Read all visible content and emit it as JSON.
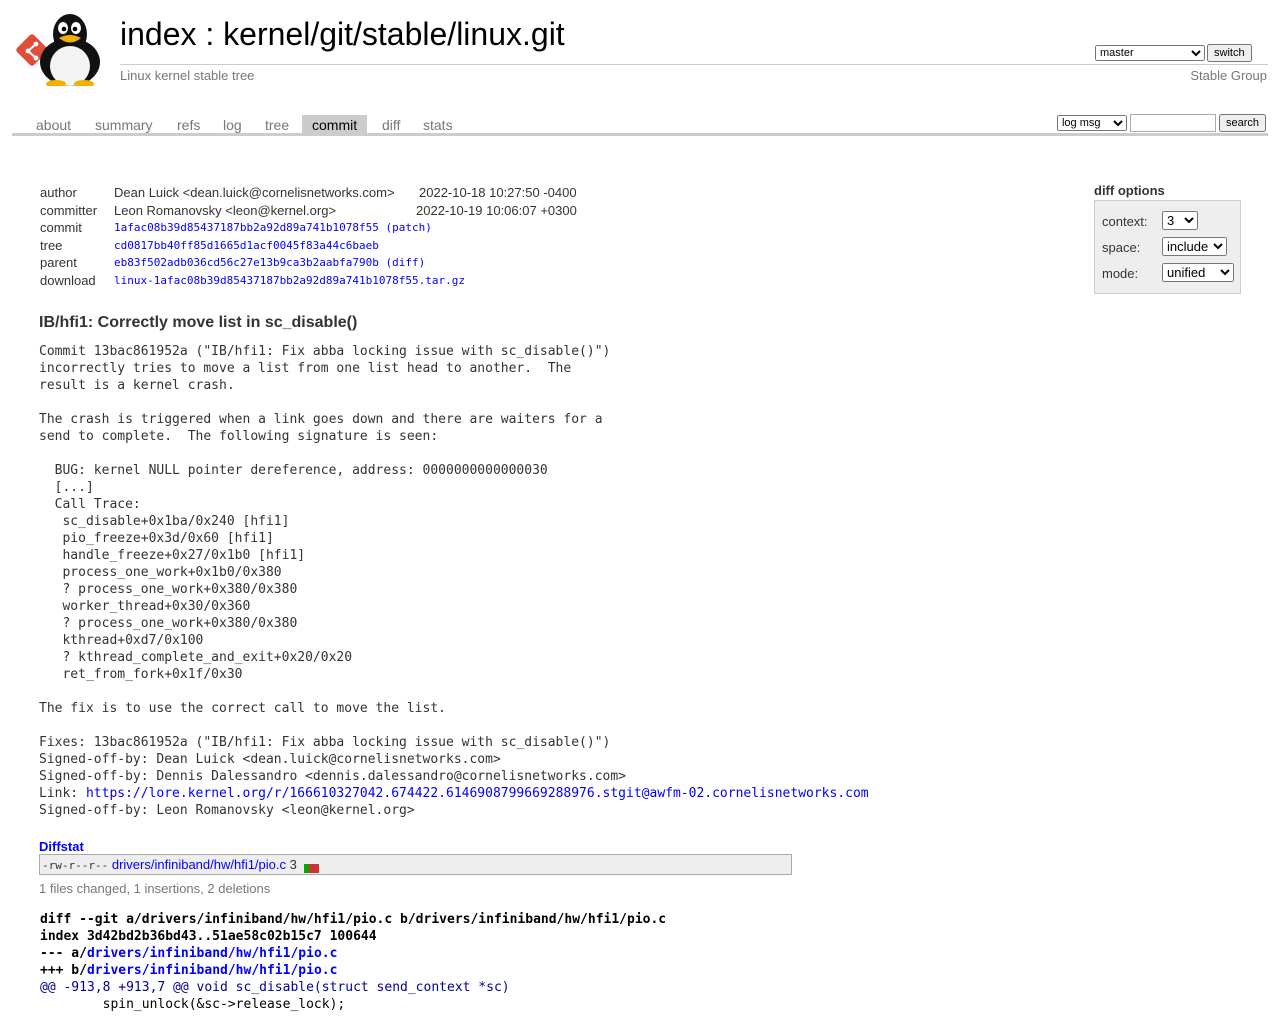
{
  "header": {
    "title_index": "index",
    "title_sep": " : ",
    "title_repo": "kernel/git/stable/linux.git",
    "subtitle": "Linux kernel stable tree",
    "owner": "Stable Group",
    "branch_selected": "master",
    "switch_label": "switch"
  },
  "tabs": [
    {
      "label": "about"
    },
    {
      "label": "summary"
    },
    {
      "label": "refs"
    },
    {
      "label": "log"
    },
    {
      "label": "tree"
    },
    {
      "label": "commit"
    },
    {
      "label": "diff"
    },
    {
      "label": "stats"
    }
  ],
  "active_tab": "commit",
  "search": {
    "type_selected": "log msg",
    "input_value": "",
    "button_label": "search"
  },
  "commit_info": {
    "author_label": "author",
    "author_value": "Dean Luick <dean.luick@cornelisnetworks.com>",
    "author_date": "2022-10-18 10:27:50 -0400",
    "committer_label": "committer",
    "committer_value": "Leon Romanovsky <leon@kernel.org>",
    "committer_date": "2022-10-19 10:06:07 +0300",
    "commit_label": "commit",
    "commit_hash": "1afac08b39d85437187bb2a92d89a741b1078f55",
    "commit_patch": "patch",
    "tree_label": "tree",
    "tree_hash": "cd0817bb40ff85d1665d1acf0045f83a44c6baeb",
    "parent_label": "parent",
    "parent_hash": "eb83f502adb036cd56c27e13b9ca3b2aabfa790b",
    "parent_diff": "diff",
    "download_label": "download",
    "download_file": "linux-1afac08b39d85437187bb2a92d89a741b1078f55.tar.gz"
  },
  "diff_options": {
    "title": "diff options",
    "context_label": "context:",
    "context_value": "3",
    "space_label": "space:",
    "space_value": "include",
    "mode_label": "mode:",
    "mode_value": "unified"
  },
  "commit": {
    "subject": "IB/hfi1: Correctly move list in sc_disable()",
    "message": "Commit 13bac861952a (\"IB/hfi1: Fix abba locking issue with sc_disable()\")\nincorrectly tries to move a list from one list head to another.  The\nresult is a kernel crash.\n\nThe crash is triggered when a link goes down and there are waiters for a\nsend to complete.  The following signature is seen:\n\n  BUG: kernel NULL pointer dereference, address: 0000000000000030\n  [...]\n  Call Trace:\n   sc_disable+0x1ba/0x240 [hfi1]\n   pio_freeze+0x3d/0x60 [hfi1]\n   handle_freeze+0x27/0x1b0 [hfi1]\n   process_one_work+0x1b0/0x380\n   ? process_one_work+0x380/0x380\n   worker_thread+0x30/0x360\n   ? process_one_work+0x380/0x380\n   kthread+0xd7/0x100\n   ? kthread_complete_and_exit+0x20/0x20\n   ret_from_fork+0x1f/0x30\n\nThe fix is to use the correct call to move the list.\n\nFixes: 13bac861952a (\"IB/hfi1: Fix abba locking issue with sc_disable()\")\nSigned-off-by: Dean Luick <dean.luick@cornelisnetworks.com>\nSigned-off-by: Dennis Dalessandro <dennis.dalessandro@cornelisnetworks.com>",
    "link_prefix": "Link: ",
    "link_url": "https://lore.kernel.org/r/166610327042.674422.6146908799669288976.stgit@awfm-02.cornelisnetworks.com",
    "message_tail": "Signed-off-by: Leon Romanovsky <leon@kernel.org>"
  },
  "diffstat": {
    "header": "Diffstat",
    "mode": "-rw-r--r--",
    "file": "drivers/infiniband/hw/hfi1/pio.c",
    "count": "3",
    "insertions": 1,
    "deletions": 2,
    "summary": "1 files changed, 1 insertions, 2 deletions"
  },
  "diff": {
    "git_line_prefix": "diff --git a/drivers/infiniband/hw/hfi1/pio.c b/drivers/infiniband/hw/hfi1/pio.c",
    "index_line": "index 3d42bd2b36bd43..51ae58c02b15c7 100644",
    "minus_prefix": "--- a/",
    "plus_prefix": "+++ b/",
    "file_path": "drivers/infiniband/hw/hfi1/pio.c",
    "hunk_header": "@@ -913,8 +913,7 @@ void sc_disable(struct send_context *sc)",
    "context_line": "        spin_unlock(&sc->release_lock);"
  },
  "colors": {
    "link": "#0000ff",
    "tab_active_bg": "#cccccc",
    "diffstat_add": "#00aa00",
    "diffstat_del": "#cc3333"
  }
}
